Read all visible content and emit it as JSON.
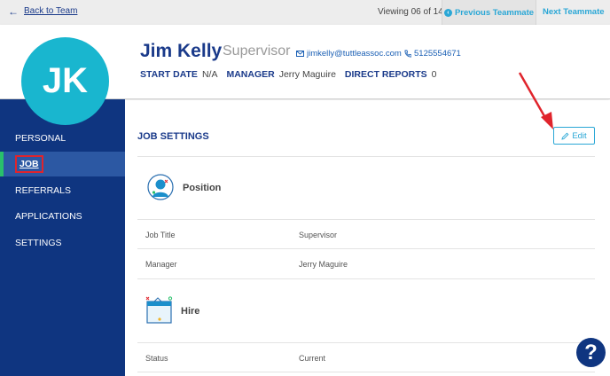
{
  "topbar": {
    "back_label": "Back to Team",
    "viewing": "Viewing 06 of 14",
    "prev_label": "Previous Teammate",
    "next_label": "Next Teammate"
  },
  "profile": {
    "initials": "JK",
    "name": "Jim Kelly",
    "role": "Supervisor",
    "email": "jimkelly@tuttleassoc.com",
    "phone": "5125554671",
    "start_date_label": "START DATE",
    "start_date": "N/A",
    "manager_label": "MANAGER",
    "manager": "Jerry Maguire",
    "direct_reports_label": "DIRECT REPORTS",
    "direct_reports": "0"
  },
  "sidebar": {
    "items": [
      {
        "label": "PERSONAL"
      },
      {
        "label": "JOB"
      },
      {
        "label": "REFERRALS"
      },
      {
        "label": "APPLICATIONS"
      },
      {
        "label": "SETTINGS"
      }
    ],
    "active_index": 1
  },
  "main": {
    "section_title": "JOB SETTINGS",
    "edit_label": "Edit",
    "position": {
      "title": "Position",
      "rows": [
        {
          "label": "Job Title",
          "value": "Supervisor"
        },
        {
          "label": "Manager",
          "value": "Jerry Maguire"
        }
      ]
    },
    "hire": {
      "title": "Hire",
      "rows": [
        {
          "label": "Status",
          "value": "Current"
        }
      ]
    }
  },
  "help": {
    "label": "?"
  },
  "colors": {
    "navy": "#0f3580",
    "accent": "#2aa7d6",
    "avatar": "#19b6cf",
    "active_marker": "#29c06b",
    "highlight": "#e0242c"
  }
}
